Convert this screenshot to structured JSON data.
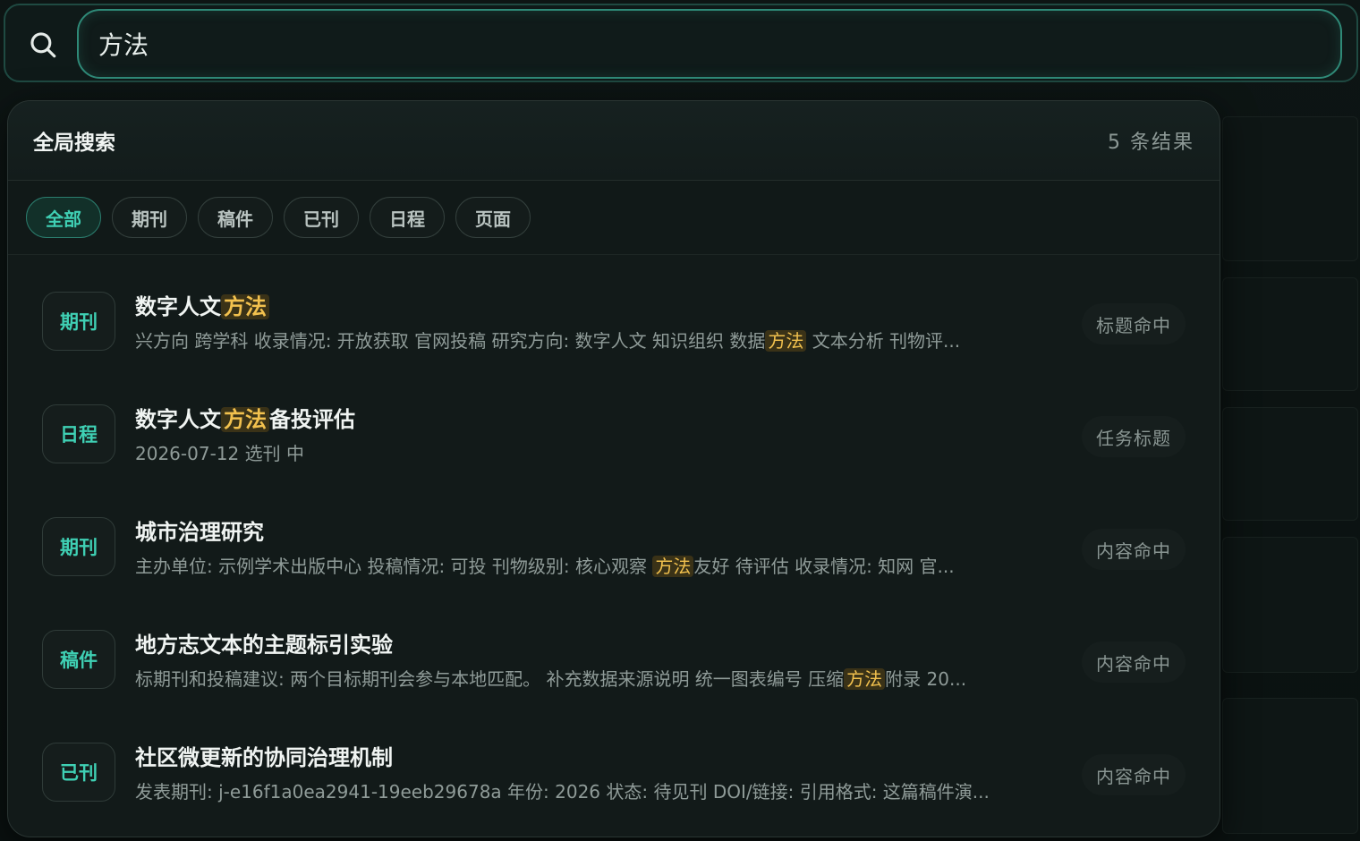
{
  "search": {
    "value": "方法",
    "placeholder": ""
  },
  "panel": {
    "title": "全局搜索",
    "count": "5 条结果"
  },
  "filters": [
    {
      "label": "全部",
      "active": true
    },
    {
      "label": "期刊",
      "active": false
    },
    {
      "label": "稿件",
      "active": false
    },
    {
      "label": "已刊",
      "active": false
    },
    {
      "label": "日程",
      "active": false
    },
    {
      "label": "页面",
      "active": false
    }
  ],
  "results": [
    {
      "badge": "期刊",
      "title": [
        "数字人文",
        "[方法]"
      ],
      "desc": [
        "兴方向 跨学科 收录情况: 开放获取 官网投稿 研究方向: 数字人文 知识组织 数据",
        "[方法]",
        " 文本分析 刊物评..."
      ],
      "tag": "标题命中"
    },
    {
      "badge": "日程",
      "title": [
        "数字人文",
        "[方法]",
        "备投评估"
      ],
      "desc": [
        "2026-07-12 选刊 中"
      ],
      "tag": "任务标题"
    },
    {
      "badge": "期刊",
      "title": [
        "城市治理研究"
      ],
      "desc": [
        "主办单位: 示例学术出版中心 投稿情况: 可投 刊物级别: 核心观察 ",
        "[方法]",
        "友好 待评估 收录情况: 知网 官..."
      ],
      "tag": "内容命中"
    },
    {
      "badge": "稿件",
      "title": [
        "地方志文本的主题标引实验"
      ],
      "desc": [
        "标期刊和投稿建议: 两个目标期刊会参与本地匹配。 补充数据来源说明 统一图表编号 压缩",
        "[方法]",
        "附录 20..."
      ],
      "tag": "内容命中"
    },
    {
      "badge": "已刊",
      "title": [
        "社区微更新的协同治理机制"
      ],
      "desc": [
        "发表期刊: j-e16f1a0ea2941-19eeb29678a 年份: 2026 状态: 待见刊 DOI/链接: 引用格式: 这篇稿件演..."
      ],
      "tag": "内容命中"
    }
  ],
  "colors": {
    "accent": "#3fd0b4",
    "highlight_bg": "#3a3217",
    "highlight_text": "#f2c14e"
  },
  "icons": {
    "search": "search-icon"
  }
}
